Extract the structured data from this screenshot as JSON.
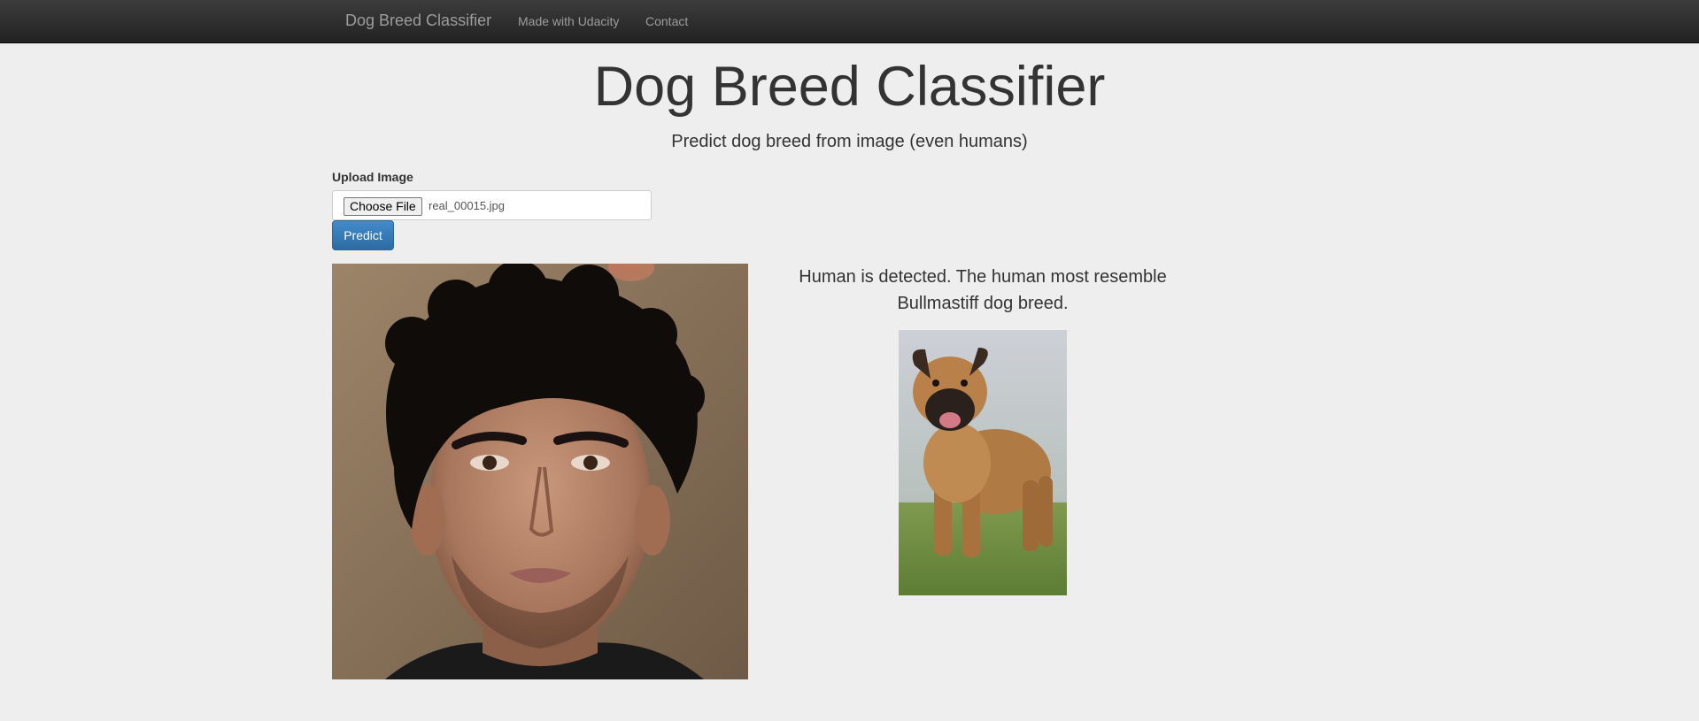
{
  "navbar": {
    "brand": "Dog Breed Classifier",
    "links": [
      "Made with Udacity",
      "Contact"
    ]
  },
  "header": {
    "title": "Dog Breed Classifier",
    "subtitle": "Predict dog breed from image (even humans)"
  },
  "form": {
    "label": "Upload Image",
    "choose_file_label": "Choose File",
    "file_name": "real_00015.jpg",
    "predict_label": "Predict"
  },
  "result": {
    "line1": "Human is detected. The human most resemble",
    "line2": "Bullmastiff dog breed."
  },
  "images": {
    "uploaded": "portrait-photo",
    "breed_example": "bullmastiff-photo"
  },
  "colors": {
    "navbar_bg": "#222222",
    "page_bg": "#eeeeee",
    "predict_button": "#337ab7"
  }
}
